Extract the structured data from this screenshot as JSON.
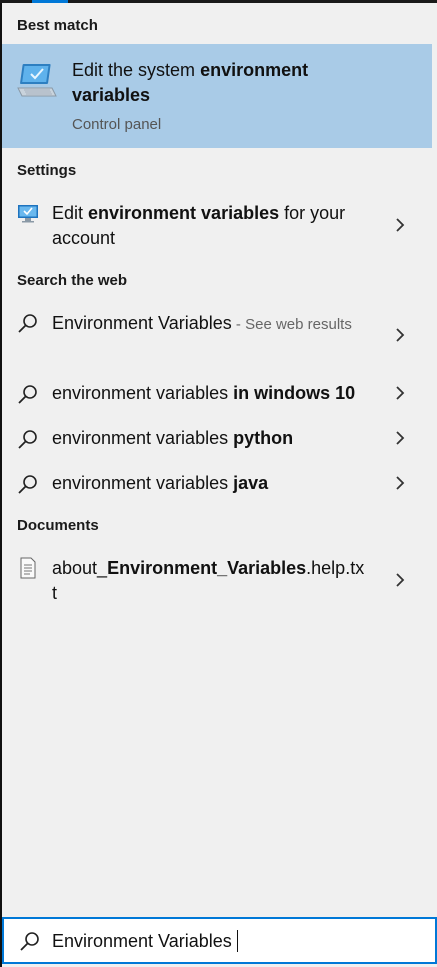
{
  "sections": {
    "best_match": "Best match",
    "settings": "Settings",
    "search_web": "Search the web",
    "documents": "Documents"
  },
  "best_match": {
    "title_pre": "Edit the system ",
    "title_bold": "environment variables",
    "subtitle": "Control panel",
    "icon": "system-computer-icon"
  },
  "settings_item": {
    "pre": "Edit ",
    "bold": "environment variables",
    "post": " for your account",
    "icon": "settings-monitor-icon"
  },
  "web_items": [
    {
      "pre": "Environment Variables",
      "bold": "",
      "suffix": " - See web results"
    },
    {
      "pre": "environment variables ",
      "bold": "in windows 10",
      "suffix": ""
    },
    {
      "pre": "environment variables ",
      "bold": "python",
      "suffix": ""
    },
    {
      "pre": "environment variables ",
      "bold": "java",
      "suffix": ""
    }
  ],
  "document_item": {
    "pre": "about_",
    "bold": "Environment_Variables",
    "post": ".help.txt",
    "icon": "text-file-icon"
  },
  "search": {
    "value": "Environment Variables",
    "icon": "search-icon"
  },
  "colors": {
    "selected_bg": "#a9cbe7",
    "panel_bg": "#f0f0f0",
    "accent": "#0078d7"
  }
}
